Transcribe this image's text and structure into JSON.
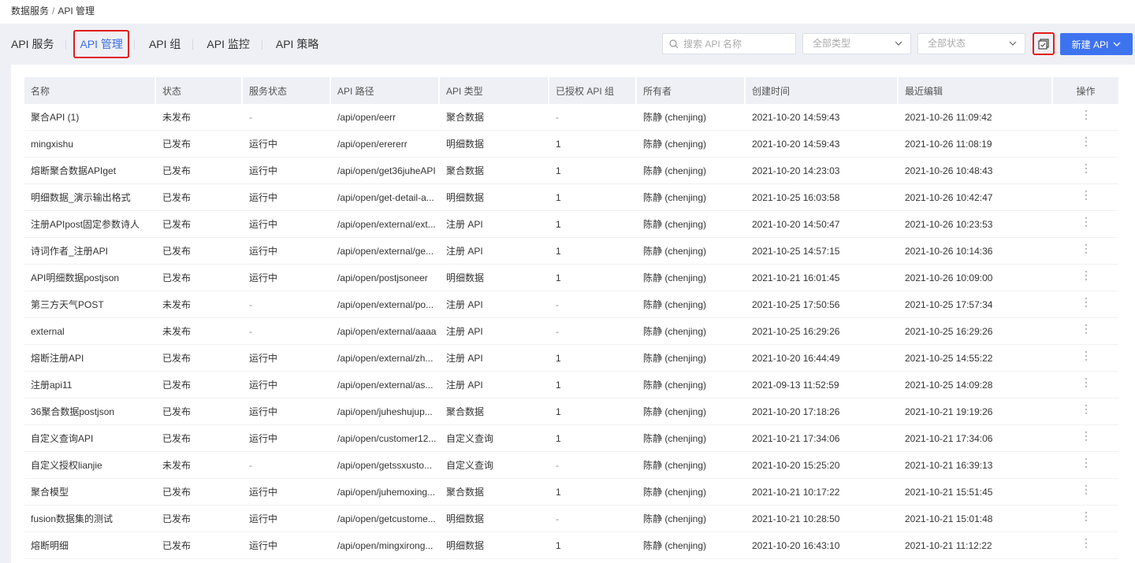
{
  "breadcrumb": {
    "parent": "数据服务",
    "separator": "/",
    "current": "API 管理"
  },
  "tabs": [
    {
      "label": "API 服务"
    },
    {
      "label": "API 管理"
    },
    {
      "label": "API 组"
    },
    {
      "label": "API 监控"
    },
    {
      "label": "API 策略"
    }
  ],
  "toolbar": {
    "search_placeholder": "搜索 API 名称",
    "type_filter": "全部类型",
    "status_filter": "全部状态",
    "new_button": "新建 API"
  },
  "colors": {
    "accent": "#3e73f0",
    "highlight_border": "#e21c1c",
    "background": "#eef0f5"
  },
  "table": {
    "columns": [
      "名称",
      "状态",
      "服务状态",
      "API 路径",
      "API 类型",
      "已授权 API 组",
      "所有者",
      "创建时间",
      "最近编辑",
      "操作"
    ],
    "rows": [
      [
        "聚合API (1)",
        "未发布",
        "-",
        "/api/open/eerr",
        "聚合数据",
        "-",
        "陈静 (chenjing)",
        "2021-10-20 14:59:43",
        "2021-10-26 11:09:42"
      ],
      [
        "mingxishu",
        "已发布",
        "运行中",
        "/api/open/erererr",
        "明细数据",
        "1",
        "陈静 (chenjing)",
        "2021-10-20 14:59:43",
        "2021-10-26 11:08:19"
      ],
      [
        "熔断聚合数据APIget",
        "已发布",
        "运行中",
        "/api/open/get36juheAPI",
        "聚合数据",
        "1",
        "陈静 (chenjing)",
        "2021-10-20 14:23:03",
        "2021-10-26 10:48:43"
      ],
      [
        "明细数据_演示输出格式",
        "已发布",
        "运行中",
        "/api/open/get-detail-a...",
        "明细数据",
        "1",
        "陈静 (chenjing)",
        "2021-10-25 16:03:58",
        "2021-10-26 10:42:47"
      ],
      [
        "注册APIpost固定参数诗人",
        "已发布",
        "运行中",
        "/api/open/external/ext...",
        "注册 API",
        "1",
        "陈静 (chenjing)",
        "2021-10-20 14:50:47",
        "2021-10-26 10:23:53"
      ],
      [
        "诗词作者_注册API",
        "已发布",
        "运行中",
        "/api/open/external/ge...",
        "注册 API",
        "1",
        "陈静 (chenjing)",
        "2021-10-25 14:57:15",
        "2021-10-26 10:14:36"
      ],
      [
        "API明细数据postjson",
        "已发布",
        "运行中",
        "/api/open/postjsoneer",
        "明细数据",
        "1",
        "陈静 (chenjing)",
        "2021-10-21 16:01:45",
        "2021-10-26 10:09:00"
      ],
      [
        "第三方天气POST",
        "未发布",
        "-",
        "/api/open/external/po...",
        "注册 API",
        "-",
        "陈静 (chenjing)",
        "2021-10-25 17:50:56",
        "2021-10-25 17:57:34"
      ],
      [
        "external",
        "未发布",
        "-",
        "/api/open/external/aaaa",
        "注册 API",
        "-",
        "陈静 (chenjing)",
        "2021-10-25 16:29:26",
        "2021-10-25 16:29:26"
      ],
      [
        "熔断注册API",
        "已发布",
        "运行中",
        "/api/open/external/zh...",
        "注册 API",
        "1",
        "陈静 (chenjing)",
        "2021-10-20 16:44:49",
        "2021-10-25 14:55:22"
      ],
      [
        "注册api11",
        "已发布",
        "运行中",
        "/api/open/external/as...",
        "注册 API",
        "1",
        "陈静 (chenjing)",
        "2021-09-13 11:52:59",
        "2021-10-25 14:09:28"
      ],
      [
        "36聚合数据postjson",
        "已发布",
        "运行中",
        "/api/open/juheshujup...",
        "聚合数据",
        "1",
        "陈静 (chenjing)",
        "2021-10-20 17:18:26",
        "2021-10-21 19:19:26"
      ],
      [
        "自定义查询API",
        "已发布",
        "运行中",
        "/api/open/customer12...",
        "自定义查询",
        "1",
        "陈静 (chenjing)",
        "2021-10-21 17:34:06",
        "2021-10-21 17:34:06"
      ],
      [
        "自定义授权lianjie",
        "未发布",
        "-",
        "/api/open/getssxusto...",
        "自定义查询",
        "-",
        "陈静 (chenjing)",
        "2021-10-20 15:25:20",
        "2021-10-21 16:39:13"
      ],
      [
        "聚合模型",
        "已发布",
        "运行中",
        "/api/open/juhemoxing...",
        "聚合数据",
        "1",
        "陈静 (chenjing)",
        "2021-10-21 10:17:22",
        "2021-10-21 15:51:45"
      ],
      [
        "fusion数据集的测试",
        "已发布",
        "运行中",
        "/api/open/getcustome...",
        "明细数据",
        "-",
        "陈静 (chenjing)",
        "2021-10-21 10:28:50",
        "2021-10-21 15:01:48"
      ],
      [
        "熔断明细",
        "已发布",
        "运行中",
        "/api/open/mingxirong...",
        "明细数据",
        "1",
        "陈静 (chenjing)",
        "2021-10-20 16:43:10",
        "2021-10-21 11:12:22"
      ]
    ]
  }
}
